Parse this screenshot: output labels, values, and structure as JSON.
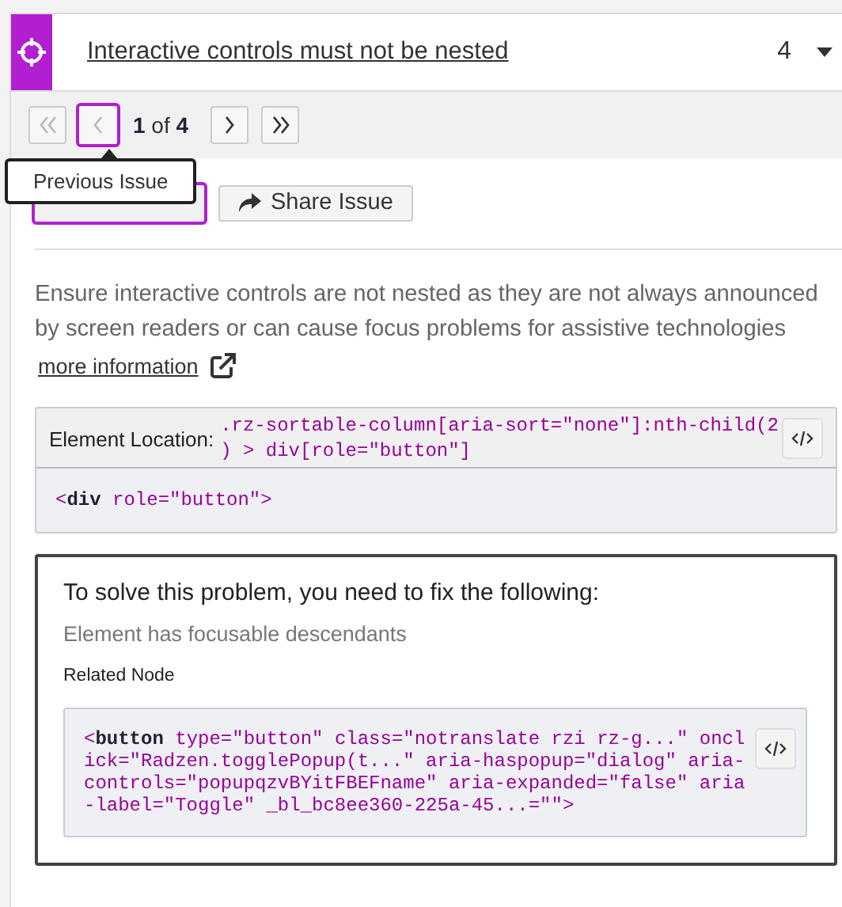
{
  "issue": {
    "title": "Interactive controls must not be nested",
    "count": "4",
    "expanded": true
  },
  "pager": {
    "buttons": [
      {
        "kind": "first",
        "disabled": true,
        "focused": false
      },
      {
        "kind": "previous",
        "disabled": true,
        "focused": true
      },
      {
        "kind": "next",
        "disabled": false,
        "focused": false
      },
      {
        "kind": "last",
        "disabled": false,
        "focused": false
      }
    ],
    "current": "1",
    "separator": "of",
    "total": "4"
  },
  "tooltip": {
    "text": "Previous Issue"
  },
  "highlight_button": {
    "focused": true
  },
  "share_button": {
    "label": "Share Issue"
  },
  "description": "Ensure interactive controls are not nested as they are not always announced by screen readers or can cause focus problems for assistive technologies",
  "more_info_link": "more information",
  "element_location": {
    "label": "Element Location:",
    "selector": ".rz-sortable-column[aria-sort=\"none\"]:nth-child(2) > div[role=\"button\"]",
    "source": "<**div** role=\"button\">"
  },
  "fix": {
    "heading": "To solve this problem, you need to fix the following:",
    "message": "Element has focusable descendants",
    "related_label": "Related Node",
    "related_code": "<**button** type=\"button\" class=\"notranslate rzi rz-g...\" onclick=\"Radzen.togglePopup(t...\" aria-haspopup=\"dialog\" aria-controls=\"popupqzvBYitFBEFname\" aria-expanded=\"false\" aria-label=\"Toggle\" _bl_bc8ee360-225a-45...=\"\">"
  }
}
